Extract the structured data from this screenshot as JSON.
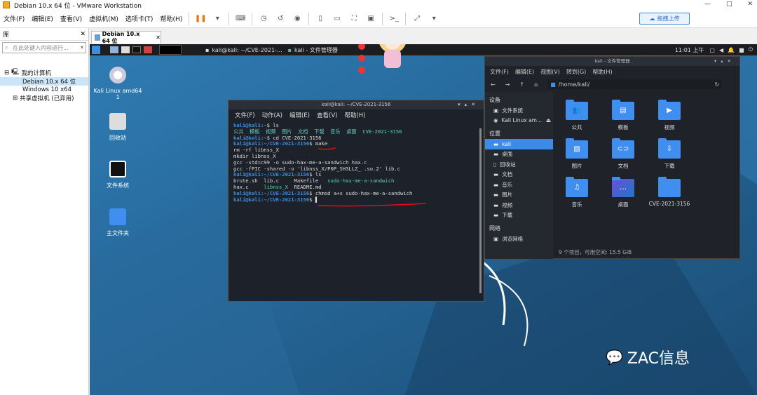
{
  "window": {
    "title": "Debian 10.x 64 位 - VMware Workstation",
    "min": "—",
    "max": "□",
    "close": "✕"
  },
  "menubar": {
    "items": [
      "文件(F)",
      "编辑(E)",
      "查看(V)",
      "虚拟机(M)",
      "选项卡(T)",
      "帮助(H)"
    ],
    "upload": "拖拽上传"
  },
  "library": {
    "title": "库",
    "close": "✕",
    "search_placeholder": "在此处键入内容进行...",
    "tree": [
      {
        "label": "我的计算机",
        "level": 0
      },
      {
        "label": "Debian 10.x 64 位",
        "level": 1,
        "selected": true
      },
      {
        "label": "Windows 10 x64",
        "level": 1
      },
      {
        "label": "共享虚拟机 (已弃用)",
        "level": 0
      }
    ]
  },
  "vmtab": {
    "label": "Debian 10.x 64 位",
    "close": "✕"
  },
  "panel": {
    "taskbar": [
      "kali@kali: ~/CVE-2021-...",
      "kali - 文件管理器"
    ],
    "time": "11:01 上午"
  },
  "desktop": {
    "icons": [
      "Kali Linux amd64 1",
      "回收站",
      "文件系统",
      "主文件夹"
    ]
  },
  "terminal": {
    "title": "kali@kali: ~/CVE-2021-3156",
    "menu": [
      "文件(F)",
      "动作(A)",
      "编辑(E)",
      "查看(V)",
      "帮助(H)"
    ],
    "lines": [
      {
        "prompt": "kali@kali",
        "path": ":~",
        "cmd": "$ ls"
      },
      {
        "out_c": "公共  模板  视频  图片  文档  下载  音乐  桌面  CVE-2021-3156"
      },
      {
        "prompt": "kali@kali",
        "path": ":~",
        "cmd": "$ cd CVE-2021-3156"
      },
      {
        "prompt": "kali@kali",
        "path": ":~/CVE-2021-3156",
        "cmd": "$ make"
      },
      {
        "out": "rm -rf libnss_X"
      },
      {
        "out": "mkdir libnss_X"
      },
      {
        "out": "gcc -std=c99 -o sudo-hax-me-a-sandwich hax.c"
      },
      {
        "out": "gcc -fPIC -shared -o 'libnss_X/P0P_SH3LLZ_ .so.2' lib.c"
      },
      {
        "prompt": "kali@kali",
        "path": ":~/CVE-2021-3156",
        "cmd": "$ ls"
      },
      {
        "out": "brute.sh  lib.c     Makefile   ",
        "out_c": "sudo-hax-me-a-sandwich"
      },
      {
        "out": "hax.c     ",
        "out_c": "libnss_X",
        "out2": "  README.md"
      },
      {
        "prompt": "kali@kali",
        "path": ":~/CVE-2021-3156",
        "cmd": "$ chmod a+x sudo-hax-me-a-sandwich"
      },
      {
        "prompt": "kali@kali",
        "path": ":~/CVE-2021-3156",
        "cmd": "$ ▌"
      }
    ]
  },
  "filemanager": {
    "title": "kali - 文件管理器",
    "menu": [
      "文件(F)",
      "编辑(E)",
      "视图(V)",
      "转到(G)",
      "帮助(H)"
    ],
    "path": "/home/kali/",
    "sections": [
      {
        "title": "设备",
        "items": [
          "文件系统",
          "Kali Linux am..."
        ]
      },
      {
        "title": "位置",
        "items": [
          "kali",
          "桌面",
          "回收站",
          "文档",
          "音乐",
          "图片",
          "视频",
          "下载"
        ]
      },
      {
        "title": "网络",
        "items": [
          "浏览网络"
        ]
      }
    ],
    "folders": [
      "公共",
      "模板",
      "视频",
      "图片",
      "文档",
      "下载",
      "音乐",
      "桌面",
      "CVE-2021-3156"
    ],
    "status": "9 个项目，可用空间: 15.5 GiB"
  },
  "watermark": "ZAC信息"
}
